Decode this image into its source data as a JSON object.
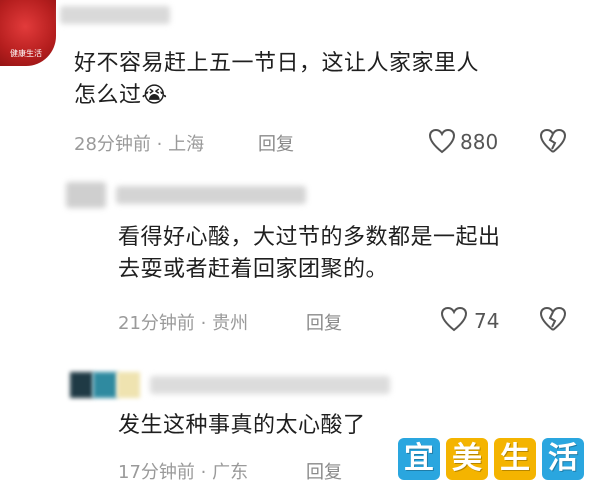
{
  "comments": [
    {
      "avatar_tag": "健康生活",
      "text_line1": "好不容易赶上五一节日，这让人家家里人",
      "text_line2": "怎么过😭",
      "meta": "28分钟前 · 上海",
      "reply_label": "回复",
      "likes": "880"
    },
    {
      "text_line1": "看得好心酸，大过节的多数都是一起出",
      "text_line2": "去耍或者赶着回家团聚的。",
      "meta": "21分钟前 · 贵州",
      "reply_label": "回复",
      "likes": "74"
    },
    {
      "text_line1": "发生这种事真的太心酸了",
      "meta": "17分钟前 · 广东",
      "reply_label": "回复"
    }
  ],
  "watermark": {
    "chars": [
      "宜",
      "美",
      "生",
      "活"
    ],
    "colors": [
      "#2aa6df",
      "#f4b400",
      "#f4b400",
      "#2aa6df"
    ]
  }
}
